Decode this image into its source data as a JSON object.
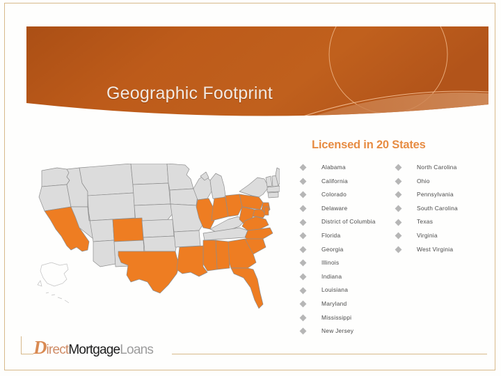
{
  "slide": {
    "title": "Geographic Footprint",
    "licensed_heading": "Licensed in 20 States",
    "accent_orange": "#ee7d22",
    "header_orange_dark": "#b05317",
    "header_orange_light": "#c4601c",
    "heading_orange": "#e78c43",
    "frame_tan": "#d7b98a",
    "map_inactive_gray": "#dcdcdc",
    "map_border_gray": "#8f8f8f"
  },
  "states": {
    "column1": [
      "Alabama",
      "California",
      "Colorado",
      "Delaware",
      "District of Columbia",
      "Florida",
      "Georgia",
      "Illinois",
      "Indiana",
      "Louisiana",
      "Maryland",
      "Mississippi",
      "New Jersey"
    ],
    "column2": [
      "North Carolina",
      "Ohio",
      "Pennsylvania",
      "South Carolina",
      "Texas",
      "Virginia",
      "West Virginia"
    ]
  },
  "map": {
    "caption": "United States map with 20 licensed states shaded orange",
    "highlighted_postal": [
      "AL",
      "CA",
      "CO",
      "DE",
      "DC",
      "FL",
      "GA",
      "IL",
      "IN",
      "LA",
      "MD",
      "MS",
      "NJ",
      "NC",
      "OH",
      "PA",
      "SC",
      "TX",
      "VA",
      "WV"
    ],
    "inset_labels": [
      "Alaska",
      "Hawaii"
    ]
  },
  "logo": {
    "part_d": "D",
    "part_irect": "irect",
    "part_mortgage": "Mortgage",
    "part_loans": "Loans",
    "full_text": "DirectMortgageLoans"
  }
}
